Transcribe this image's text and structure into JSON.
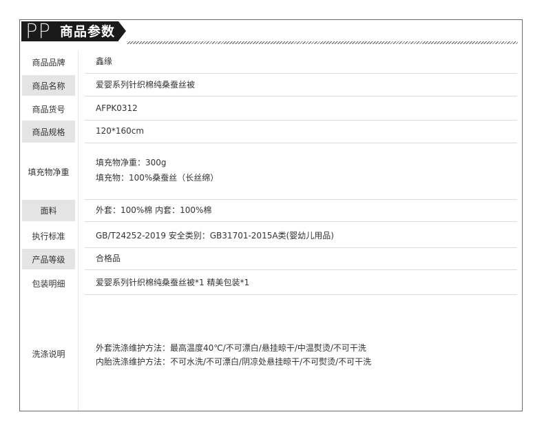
{
  "header": {
    "logo_text": "PP",
    "title": "商品参数"
  },
  "rows": [
    {
      "label": "商品品牌",
      "values": [
        "鑫缘"
      ]
    },
    {
      "label": "商品名称",
      "values": [
        "爱婴系列针织棉纯桑蚕丝被"
      ]
    },
    {
      "label": "商品货号",
      "values": [
        "AFPK0312"
      ]
    },
    {
      "label": "商品规格",
      "values": [
        "120*160cm"
      ]
    },
    {
      "label": "填充物净重",
      "values": [
        "填充物净重：300g",
        "填充物：100%桑蚕丝（长丝绵）"
      ]
    },
    {
      "label": "面料",
      "values": [
        "外套：100%棉  内套：100%棉"
      ]
    },
    {
      "label": "执行标准",
      "values": [
        "GB/T24252-2019   安全类别：GB31701-2015A类(婴幼儿用品)"
      ]
    },
    {
      "label": "产品等级",
      "values": [
        "合格品"
      ]
    },
    {
      "label": "包装明细",
      "values": [
        "爱婴系列针织棉纯桑蚕丝被*1  精美包装*1"
      ]
    },
    {
      "label": "洗涤说明",
      "values": [
        "外套洗涤维护方法：最高温度40℃/不可漂白/悬挂晾干/中温熨烫/不可干洗",
        "内胎洗涤维护方法：不可水洗/不可漂白/阴凉处悬挂晾干/不可熨烫/不可干洗"
      ]
    }
  ],
  "colors": {
    "frame_border": "#6b6b6b",
    "header_bg": "#1a1a1a",
    "label_shade": "#e4e4e4",
    "rule": "#dcdcdc"
  }
}
